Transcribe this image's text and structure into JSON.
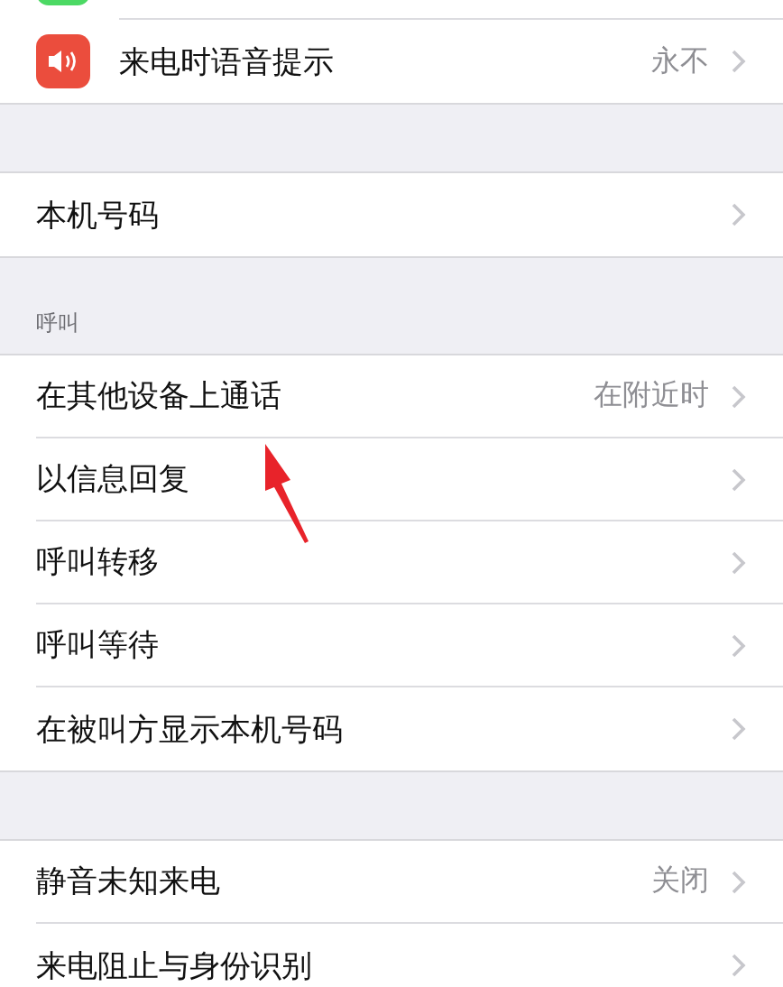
{
  "groups": [
    {
      "rows": [
        {
          "color": "#4cd964"
        },
        {
          "label": "来电时语音提示",
          "value": "永不",
          "color": "#eb4d3d"
        }
      ]
    },
    {
      "rows": [
        {
          "label": "本机号码"
        }
      ]
    },
    {
      "header": "呼叫",
      "rows": [
        {
          "label": "在其他设备上通话",
          "value": "在附近时"
        },
        {
          "label": "以信息回复"
        },
        {
          "label": "呼叫转移"
        },
        {
          "label": "呼叫等待"
        },
        {
          "label": "在被叫方显示本机号码"
        }
      ]
    },
    {
      "rows": [
        {
          "label": "静音未知来电",
          "value": "关闭"
        },
        {
          "label": "来电阻止与身份识别"
        }
      ]
    }
  ]
}
